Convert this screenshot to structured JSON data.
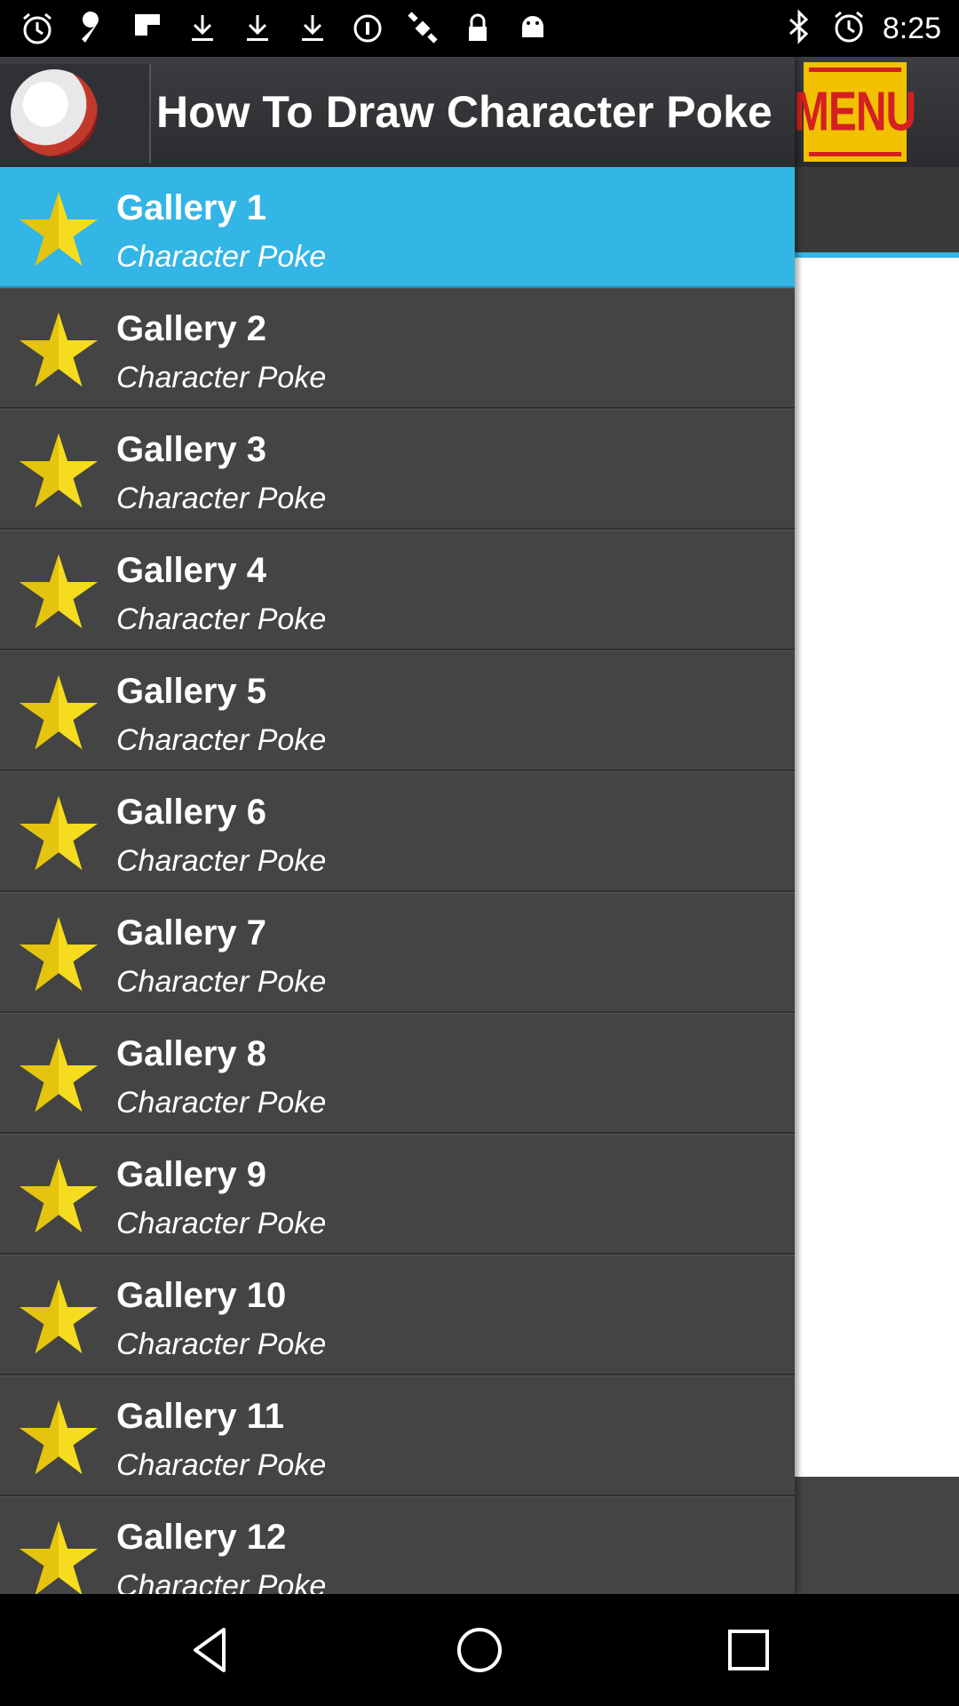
{
  "status_bar": {
    "time": "8:25",
    "left_icons": [
      "alarm-icon",
      "wrench-icon",
      "flipboard-icon",
      "download-icon",
      "download-icon",
      "download-icon",
      "data-saver-icon",
      "satellite-icon",
      "lock-icon",
      "android-icon"
    ],
    "right_icons": [
      "bluetooth-icon",
      "alarm-icon"
    ]
  },
  "header": {
    "title": "How To Draw Character Poke",
    "menu_button_label": "MENU"
  },
  "drawer": {
    "items": [
      {
        "title": "Gallery 1",
        "subtitle": "Character Poke",
        "active": true
      },
      {
        "title": "Gallery 2",
        "subtitle": "Character Poke"
      },
      {
        "title": "Gallery 3",
        "subtitle": "Character Poke"
      },
      {
        "title": "Gallery 4",
        "subtitle": "Character Poke"
      },
      {
        "title": "Gallery 5",
        "subtitle": "Character Poke"
      },
      {
        "title": "Gallery 6",
        "subtitle": "Character Poke"
      },
      {
        "title": "Gallery 7",
        "subtitle": "Character Poke"
      },
      {
        "title": "Gallery 8",
        "subtitle": "Character Poke"
      },
      {
        "title": "Gallery 9",
        "subtitle": "Character Poke"
      },
      {
        "title": "Gallery 10",
        "subtitle": "Character Poke"
      },
      {
        "title": "Gallery 11",
        "subtitle": "Character Poke"
      },
      {
        "title": "Gallery 12",
        "subtitle": "Character Poke"
      }
    ]
  },
  "colors": {
    "accent": "#33b5e5",
    "drawer_bg": "#444444",
    "star": "#f5dc1e",
    "menu_yellow": "#f2c200",
    "menu_red": "#d42020"
  },
  "nav_bar": {
    "buttons": [
      "back-icon",
      "home-icon",
      "recents-icon"
    ]
  }
}
